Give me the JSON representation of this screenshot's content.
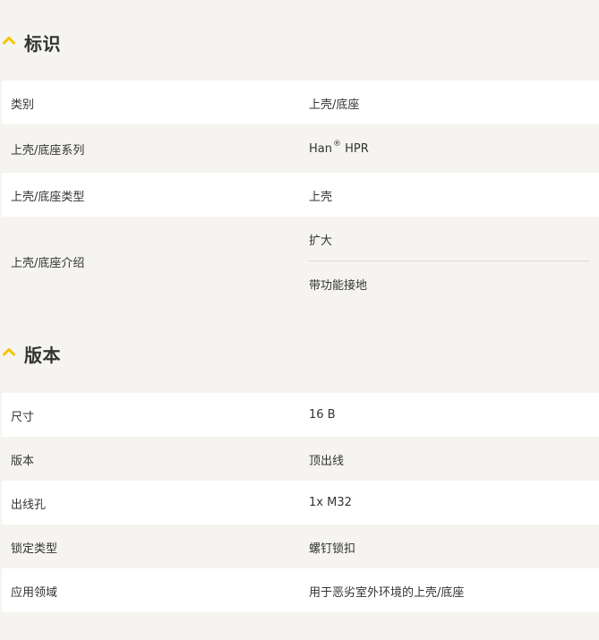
{
  "colors": {
    "accent": "#f5c400",
    "page_background": "#f5f4f0",
    "row_white": "#ffffff",
    "row_grey": "#f5f4f0",
    "text": "#333333"
  },
  "sections": {
    "identification": {
      "title": "标识",
      "icon": "chevron-up-icon",
      "rows": {
        "category": {
          "label": "类别",
          "value": "上壳/底座"
        },
        "series": {
          "label": "上壳/底座系列",
          "value": "Han",
          "value_suffix": "®",
          "value_tail": " HPR"
        },
        "type": {
          "label": "上壳/底座类型",
          "value": "上壳"
        },
        "intro": {
          "label": "上壳/底座介绍",
          "values": [
            "扩大",
            "带功能接地"
          ]
        }
      }
    },
    "version": {
      "title": "版本",
      "icon": "chevron-up-icon",
      "rows": {
        "size": {
          "label": "尺寸",
          "value": "16 B"
        },
        "version": {
          "label": "版本",
          "value": "顶出线"
        },
        "outlet": {
          "label": "出线孔",
          "value": "1x M32"
        },
        "locking": {
          "label": "锁定类型",
          "value": "螺钉锁扣"
        },
        "application": {
          "label": "应用领域",
          "value": "用于恶劣室外环境的上壳/底座"
        }
      }
    }
  }
}
